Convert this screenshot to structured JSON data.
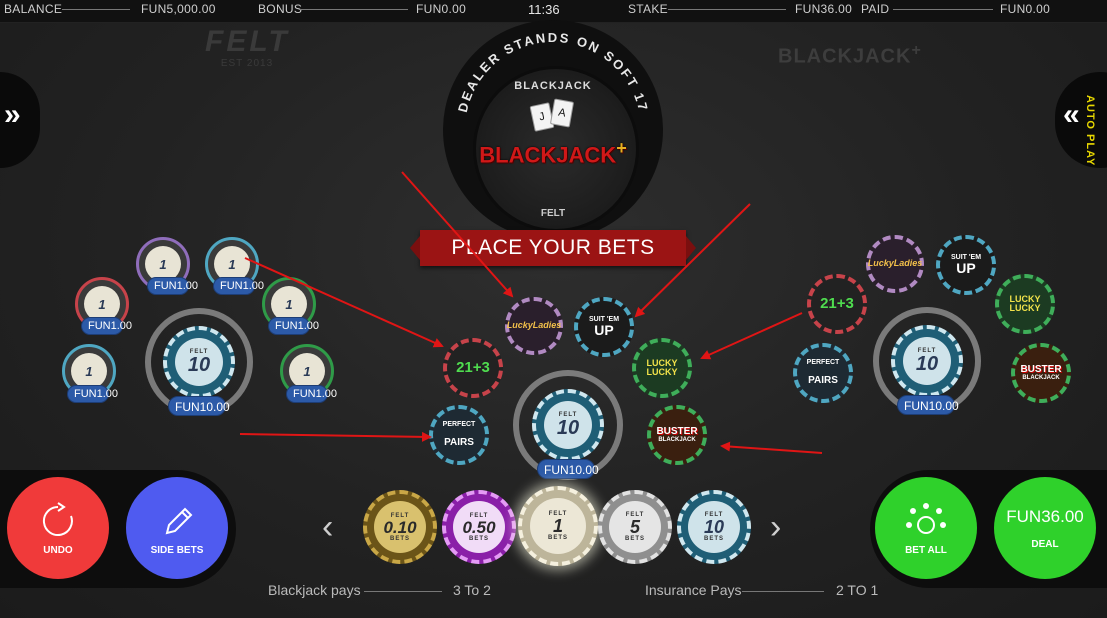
{
  "topbar": {
    "balance_label": "BALANCE",
    "balance_value": "FUN5,000.00",
    "bonus_label": "BONUS",
    "bonus_value": "FUN0.00",
    "clock": "11:36",
    "stake_label": "STAKE",
    "stake_value": "FUN36.00",
    "paid_label": "PAID",
    "paid_value": "FUN0.00"
  },
  "logos": {
    "felt_big": "FELT",
    "felt_small": "EST 2013",
    "blackjack_plus": "BLACKJACK",
    "plus": "+"
  },
  "autoplay_label": "AUTO PLAY",
  "dealer": {
    "ring_text": "DEALER STANDS ON SOFT 17",
    "inner_top": "BLACKJACK",
    "main": "BLACKJACK",
    "main_plus": "+",
    "felt": "FELT",
    "card_left": "J",
    "card_right": "A"
  },
  "banner": "PLACE YOUR BETS",
  "left_seat": {
    "main_chip": "1",
    "main_bet_chip": "10",
    "main_amount": "FUN10.00",
    "side_amounts": [
      "FUN1.00",
      "FUN1.00",
      "FUN1.00",
      "FUN1.00",
      "FUN1.00",
      "FUN1.00"
    ]
  },
  "center_seat": {
    "main_bet_chip": "10",
    "main_amount": "FUN10.00",
    "side_bets": {
      "lucky_ladies": "LuckyLadies",
      "suit_em_up_top": "SUIT 'EM",
      "suit_em_up_bottom": "UP",
      "twenty_one_three": "21+3",
      "lucky_lucky": "LUCKY LUCKY",
      "perfect_pairs_top": "PERFECT",
      "perfect_pairs_bottom": "PAIRS",
      "buster": "BUSTER",
      "buster_sub": "BLACKJACK"
    }
  },
  "right_seat": {
    "main_bet_chip": "10",
    "main_amount": "FUN10.00"
  },
  "chip_felt_label": "FELT",
  "chip_bets_label": "BETS",
  "chips": [
    {
      "value": "0.10",
      "color": "#6b5418"
    },
    {
      "value": "0.50",
      "color": "#8a1fa8"
    },
    {
      "value": "1",
      "color": "#e9e4d4"
    },
    {
      "value": "5",
      "color": "#c9c9c9"
    },
    {
      "value": "10",
      "color": "#7fb4c8"
    }
  ],
  "buttons": {
    "undo": "UNDO",
    "side_bets": "SIDE BETS",
    "bet_all": "BET ALL",
    "deal_amount": "FUN36.00",
    "deal": "DEAL"
  },
  "pays": {
    "blackjack_label": "Blackjack pays",
    "blackjack_value": "3 To 2",
    "insurance_label": "Insurance Pays",
    "insurance_value": "2 TO 1"
  },
  "colors": {
    "undo": "#f03a3a",
    "side_bets": "#4f5bf0",
    "bet_all": "#2fd12b",
    "deal": "#2fd12b",
    "banner": "#9b1414",
    "amount_badge": "#2c5aa8",
    "autoplay": "#e8d800"
  }
}
